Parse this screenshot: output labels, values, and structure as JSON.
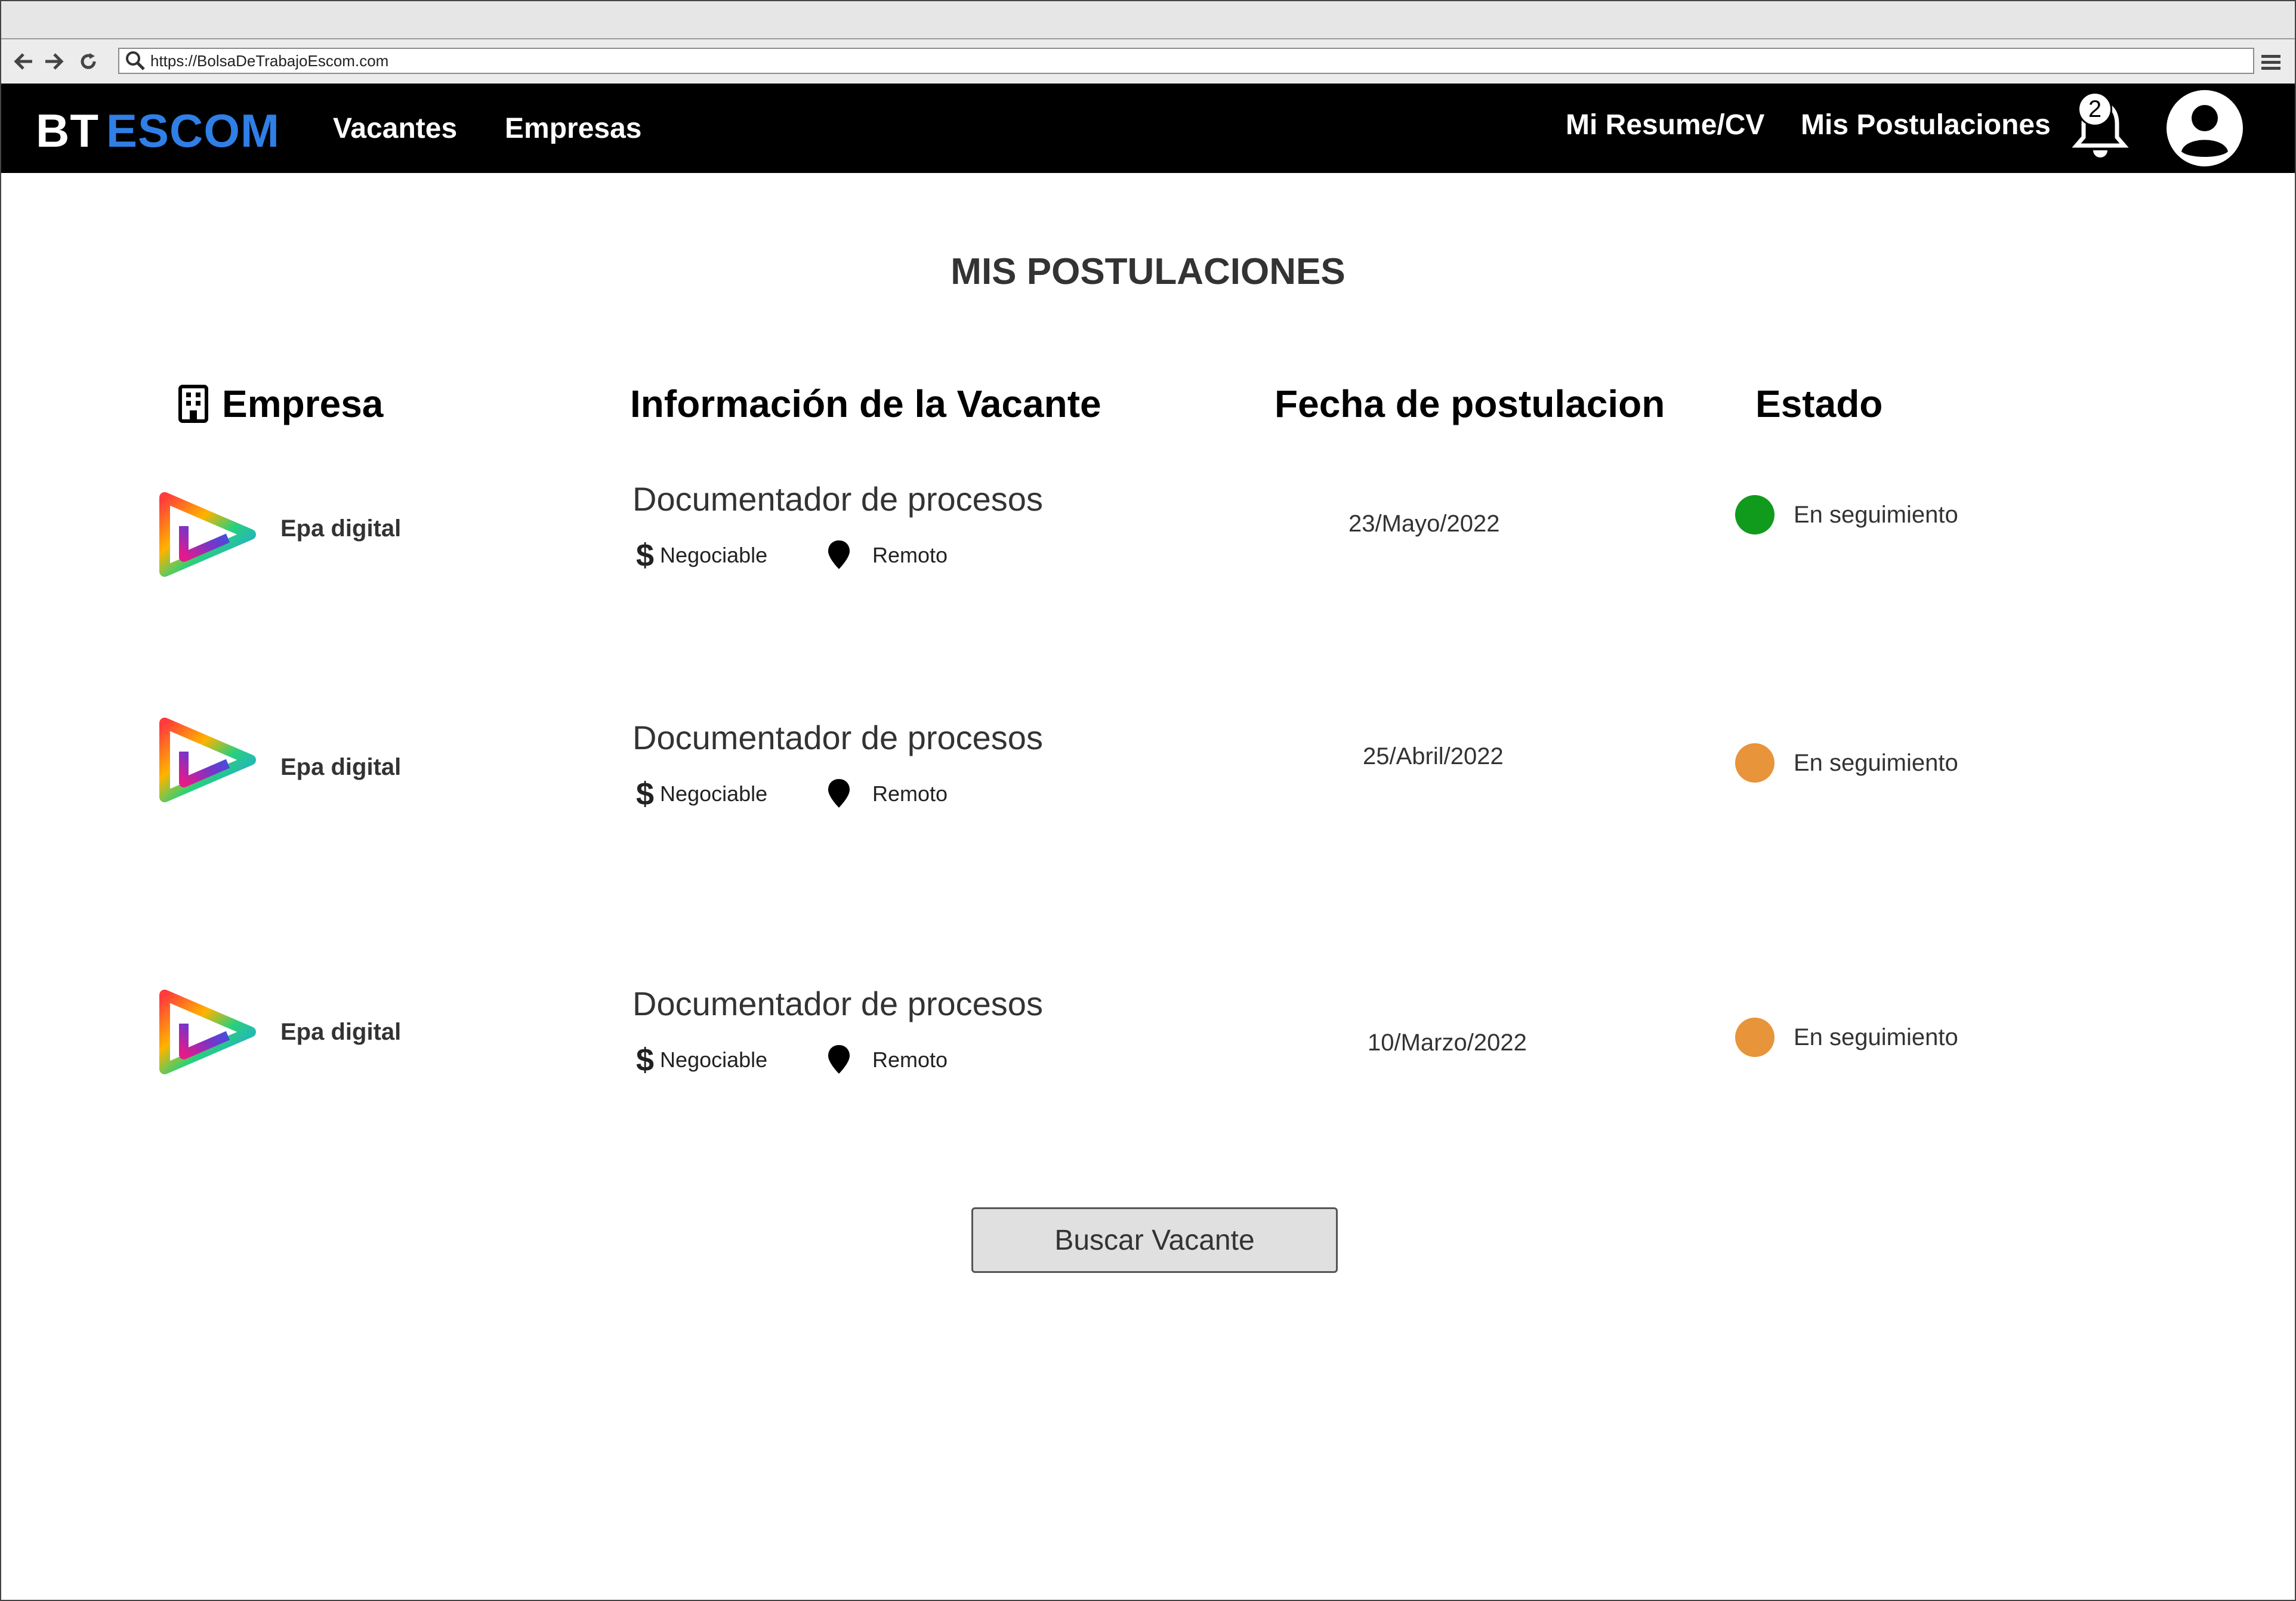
{
  "browser": {
    "url": "https://BolsaDeTrabajoEscom.com",
    "icons": [
      "back-arrow-icon",
      "forward-arrow-icon",
      "reload-icon",
      "search-icon",
      "hamburger-menu-icon"
    ]
  },
  "navbar": {
    "brand_bt": "BT",
    "brand_escom": "ESCOM",
    "links": {
      "vacantes": "Vacantes",
      "empresas": "Empresas",
      "resume": "Mi Resume/CV",
      "postulaciones": "Mis Postulaciones"
    },
    "notification_count": "2"
  },
  "page": {
    "title": "MIS POSTULACIONES"
  },
  "table": {
    "headers": {
      "empresa": "Empresa",
      "vacante": "Información de la Vacante",
      "fecha": "Fecha de postulacion",
      "estado": "Estado"
    },
    "rows": [
      {
        "company": "Epa digital",
        "job_title": "Documentador de procesos",
        "salary": "Negociable",
        "location": "Remoto",
        "date": "23/Mayo/2022",
        "status": "En seguimiento",
        "status_color": "#109b1c"
      },
      {
        "company": "Epa digital",
        "job_title": "Documentador de procesos",
        "salary": "Negociable",
        "location": "Remoto",
        "date": "25/Abril/2022",
        "status": "En seguimiento",
        "status_color": "#e8943a"
      },
      {
        "company": "Epa digital",
        "job_title": "Documentador de procesos",
        "salary": "Negociable",
        "location": "Remoto",
        "date": "10/Marzo/2022",
        "status": "En seguimiento",
        "status_color": "#e8943a"
      }
    ]
  },
  "actions": {
    "search_button": "Buscar Vacante"
  },
  "colors": {
    "navbar_bg": "#000000",
    "brand_accent": "#2f7fe6",
    "button_bg": "#e0e0e0"
  }
}
